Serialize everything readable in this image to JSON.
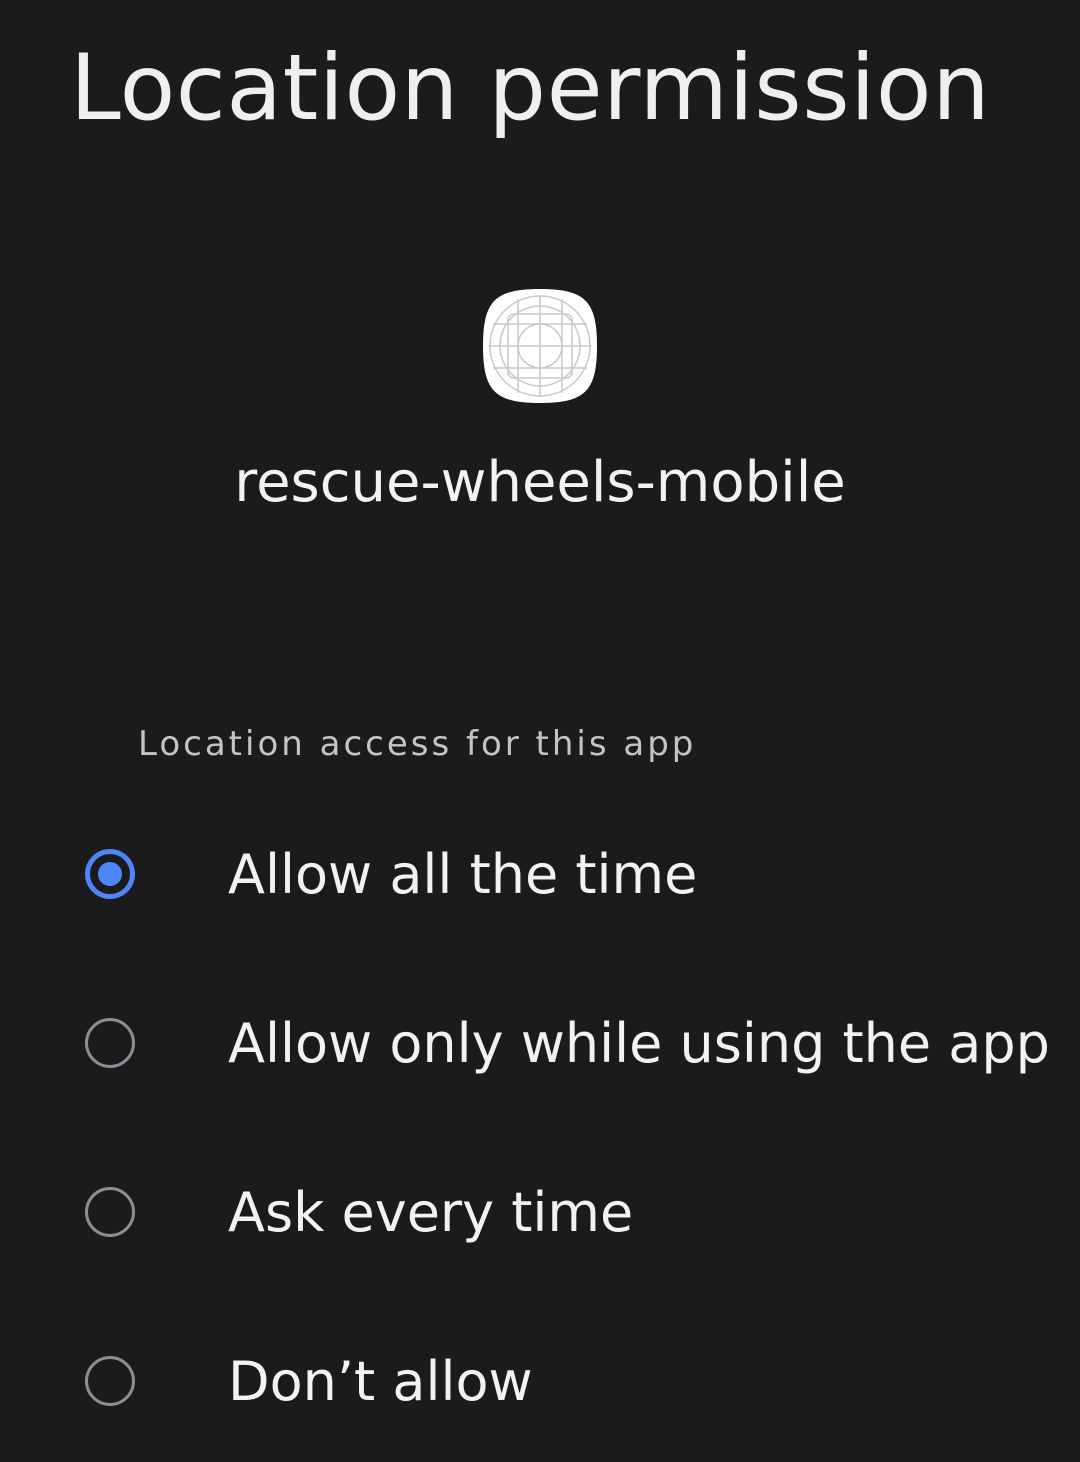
{
  "header": {
    "title": "Location permission"
  },
  "app": {
    "icon": "app-placeholder-icon",
    "name": "rescue-wheels-mobile"
  },
  "section": {
    "label": "Location access for this app"
  },
  "options": [
    {
      "label": "Allow all the time",
      "selected": true
    },
    {
      "label": "Allow only while using the app",
      "selected": false
    },
    {
      "label": "Ask every time",
      "selected": false
    },
    {
      "label": "Don’t allow",
      "selected": false
    }
  ],
  "colors": {
    "background": "#1b1b1e",
    "accent": "#4f86f7",
    "radio_unselected": "#8e8e92",
    "text_primary": "#f2f2f2",
    "text_secondary": "#c4c4c7"
  }
}
